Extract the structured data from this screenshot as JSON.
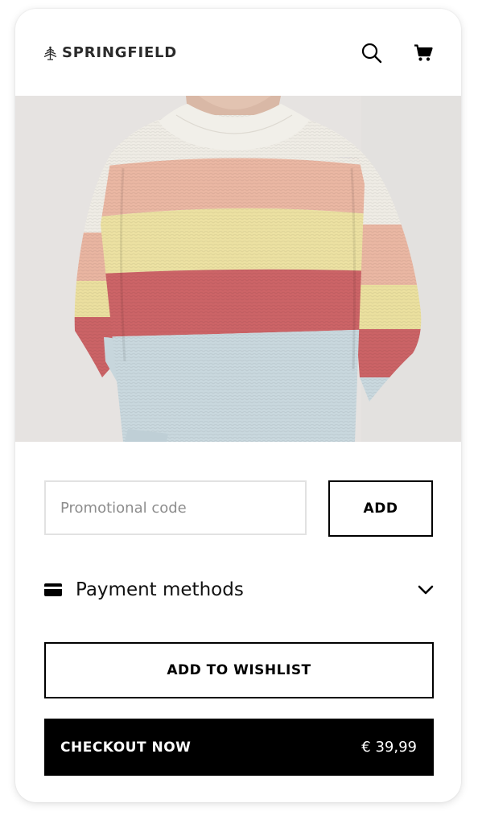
{
  "header": {
    "brand_name": "SPRINGFIELD",
    "logo_icon": "tree-logo-icon",
    "search_icon": "search-icon",
    "cart_icon": "cart-icon"
  },
  "product": {
    "image_description": "striped-sweater-photo"
  },
  "promo": {
    "placeholder": "Promotional code",
    "value": "",
    "add_label": "ADD"
  },
  "payment": {
    "label": "Payment methods",
    "icon": "credit-card-icon",
    "toggle_icon": "chevron-down-icon"
  },
  "actions": {
    "wishlist_label": "ADD TO WISHLIST",
    "checkout_label": "CHECKOUT NOW",
    "price": "€ 39,99"
  },
  "colors": {
    "primary": "#000000",
    "background": "#ffffff",
    "input_border": "#e2e2e2",
    "stripe_cream": "#efece5",
    "stripe_peach": "#eab7a3",
    "stripe_yellow": "#ece1a2",
    "stripe_red": "#cc6467",
    "stripe_blue": "#c9d8de"
  }
}
